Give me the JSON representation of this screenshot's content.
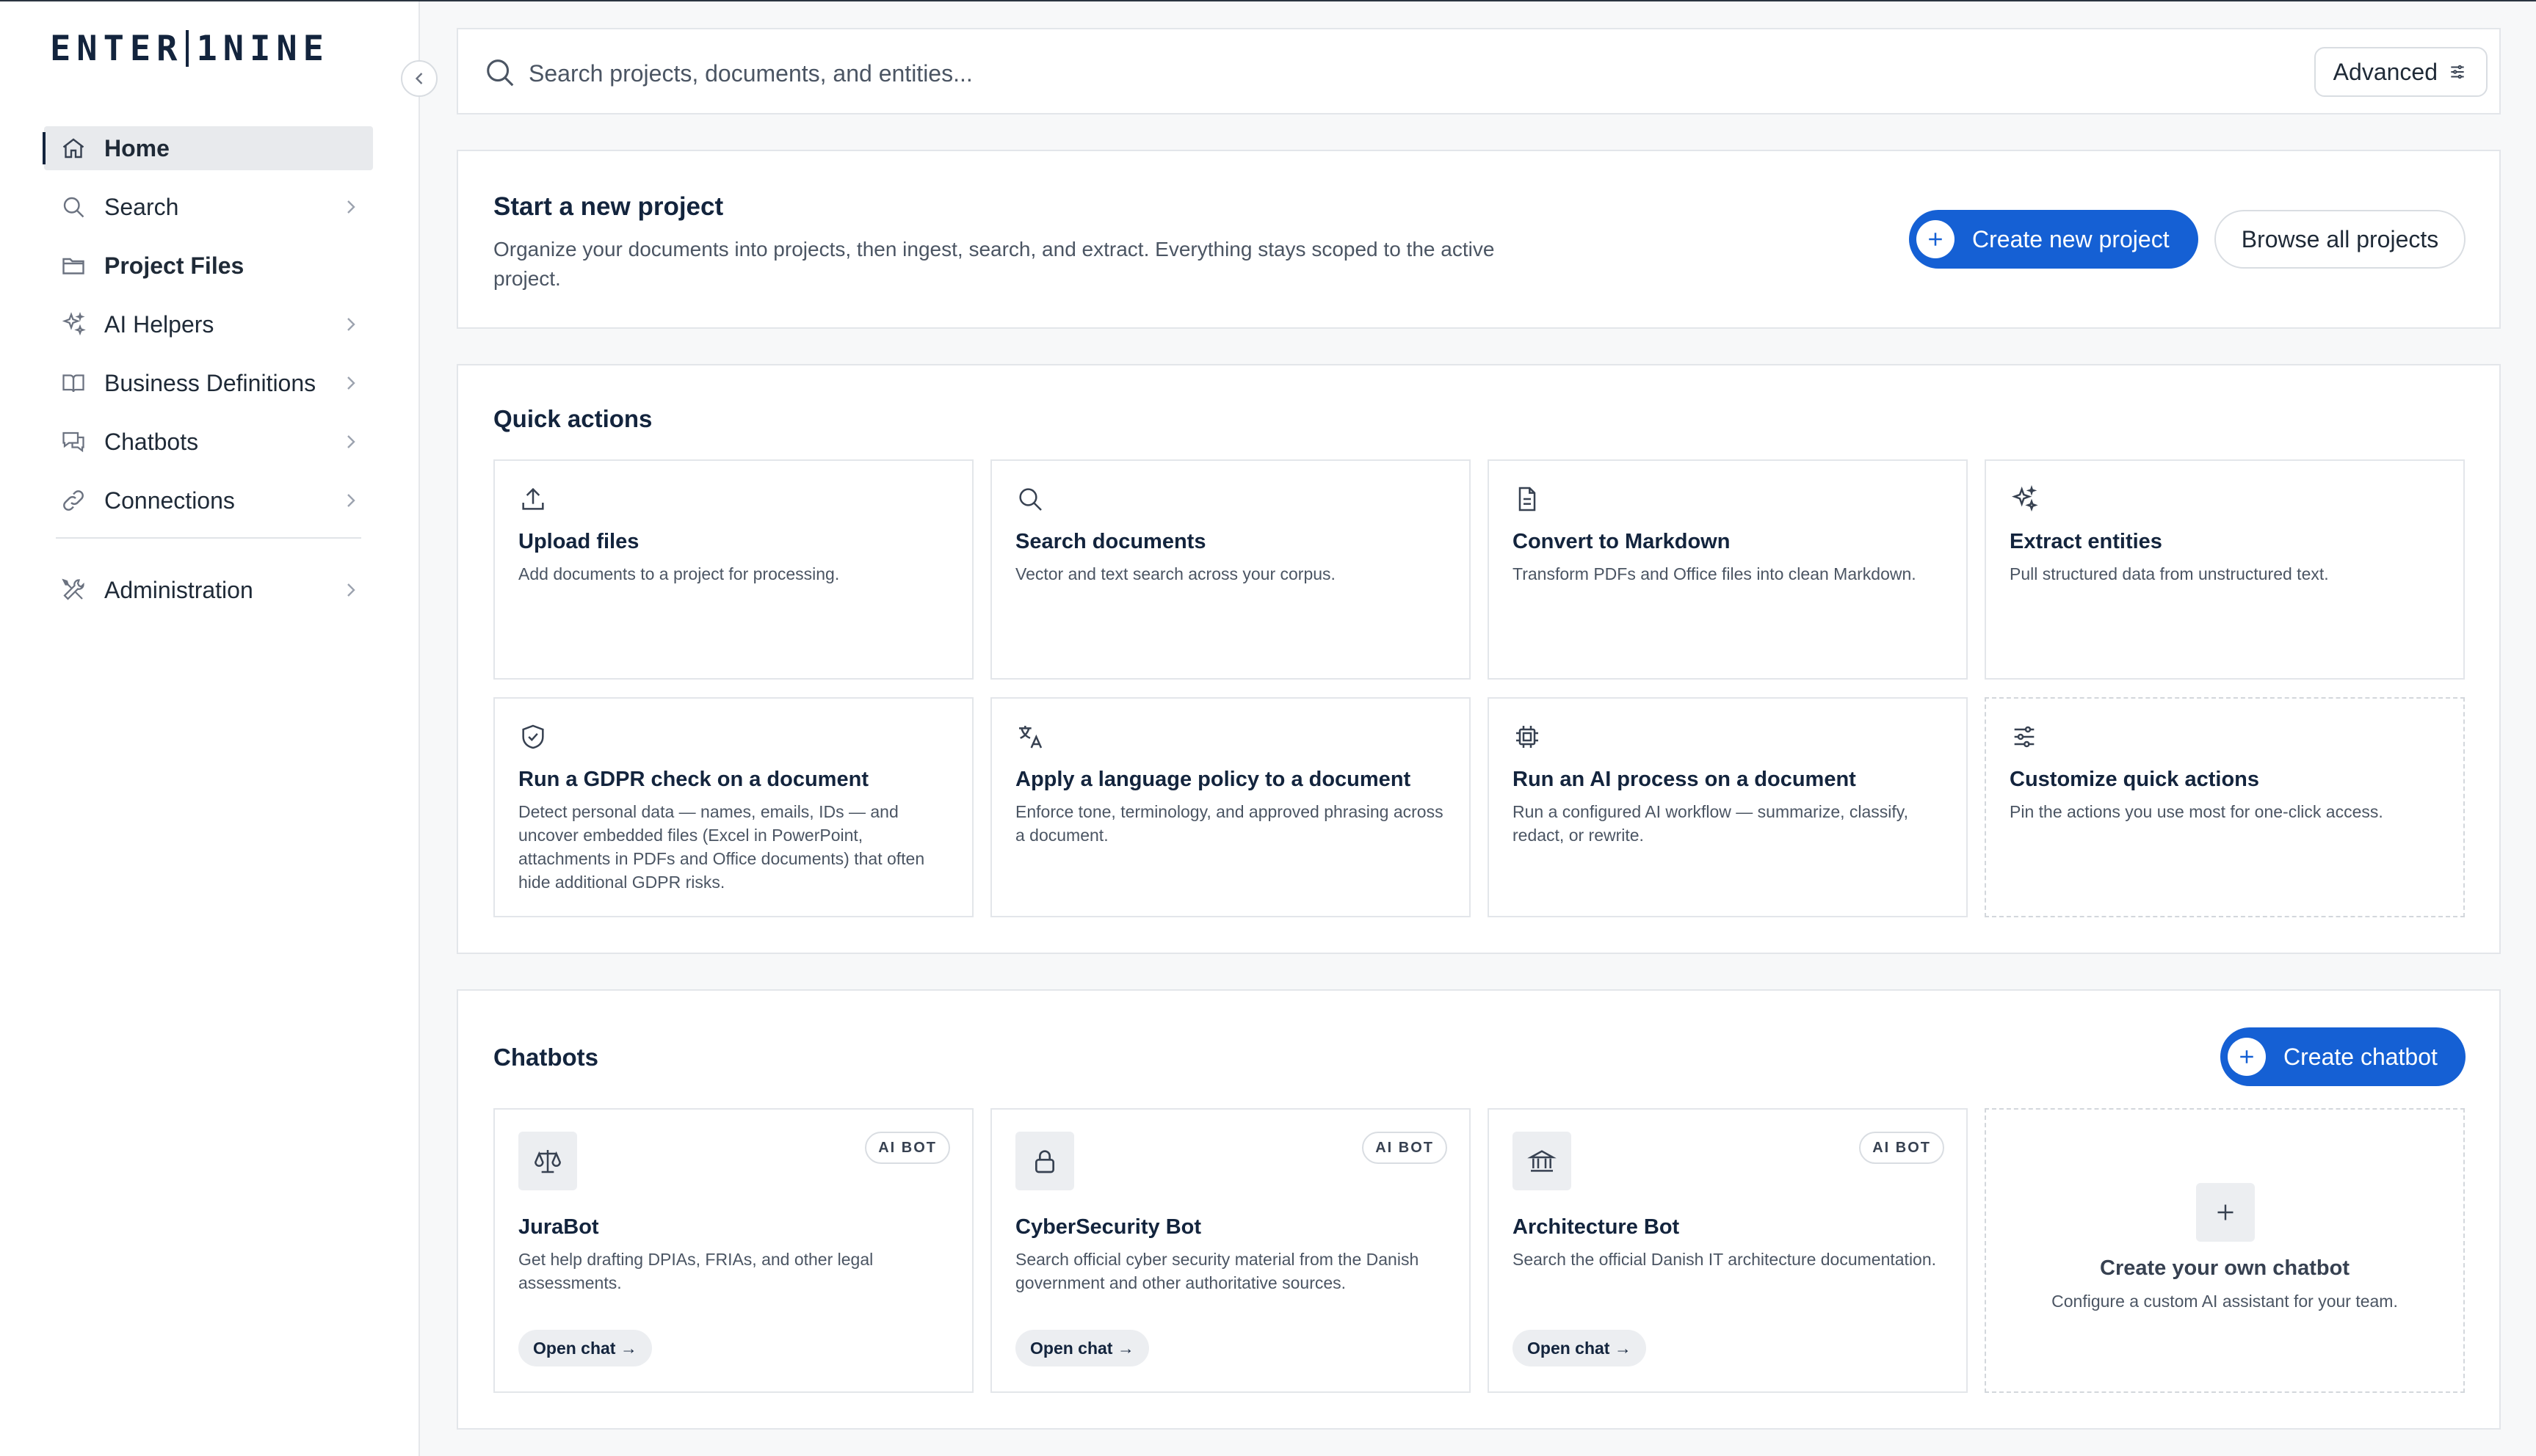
{
  "app": {
    "logo_left": "ENTER",
    "logo_right": "1NINE"
  },
  "colors": {
    "primary": "#1560d4",
    "navy": "#13243d",
    "muted": "#4b5563",
    "border": "#e3e6ea"
  },
  "sidebar": {
    "items": [
      {
        "label": "Home",
        "icon": "home-icon",
        "active": true,
        "chevron": false
      },
      {
        "label": "Search",
        "icon": "search-icon",
        "chevron": true
      },
      {
        "label": "Project Files",
        "icon": "folder-icon",
        "chevron": false,
        "bold": true
      },
      {
        "label": "AI Helpers",
        "icon": "sparkles-icon",
        "chevron": true
      },
      {
        "label": "Business Definitions",
        "icon": "book-icon",
        "chevron": true
      },
      {
        "label": "Chatbots",
        "icon": "chat-icon",
        "chevron": true
      },
      {
        "label": "Connections",
        "icon": "link-icon",
        "chevron": true
      },
      {
        "label": "Administration",
        "icon": "tools-icon",
        "chevron": true
      }
    ]
  },
  "search": {
    "placeholder": "Search projects, documents, and entities...",
    "advanced_label": "Advanced"
  },
  "new_project": {
    "title": "Start a new project",
    "description": "Organize your documents into projects, then ingest, search, and extract. Everything stays scoped to the active project.",
    "create_label": "Create new project",
    "browse_label": "Browse all projects"
  },
  "quick_actions": {
    "title": "Quick actions",
    "items": [
      {
        "title": "Upload files",
        "desc": "Add documents to a project for processing.",
        "icon": "upload-icon"
      },
      {
        "title": "Search documents",
        "desc": "Vector and text search across your corpus.",
        "icon": "search-icon"
      },
      {
        "title": "Convert to Markdown",
        "desc": "Transform PDFs and Office files into clean Markdown.",
        "icon": "document-icon"
      },
      {
        "title": "Extract entities",
        "desc": "Pull structured data from unstructured text.",
        "icon": "sparkles-icon"
      },
      {
        "title": "Run a GDPR check on a document",
        "desc": "Detect personal data — names, emails, IDs — and uncover embedded files (Excel in PowerPoint, attachments in PDFs and Office documents) that often hide additional GDPR risks.",
        "icon": "shield-check-icon"
      },
      {
        "title": "Apply a language policy to a document",
        "desc": "Enforce tone, terminology, and approved phrasing across a document.",
        "icon": "translate-icon"
      },
      {
        "title": "Run an AI process on a document",
        "desc": "Run a configured AI workflow — summarize, classify, redact, or rewrite.",
        "icon": "chip-icon"
      },
      {
        "title": "Customize quick actions",
        "desc": "Pin the actions you use most for one-click access.",
        "icon": "sliders-icon"
      }
    ]
  },
  "chatbots": {
    "title": "Chatbots",
    "create_label": "Create chatbot",
    "badge": "AI BOT",
    "open_label": "Open chat →",
    "items": [
      {
        "title": "JuraBot",
        "desc": "Get help drafting DPIAs, FRIAs, and other legal assessments.",
        "icon": "scale-icon"
      },
      {
        "title": "CyberSecurity Bot",
        "desc": "Search official cyber security material from the Danish government and other authoritative sources.",
        "icon": "lock-icon"
      },
      {
        "title": "Architecture Bot",
        "desc": "Search the official Danish IT architecture documentation.",
        "icon": "bank-icon"
      }
    ],
    "create_own": {
      "title": "Create your own chatbot",
      "desc": "Configure a custom AI assistant for your team."
    }
  }
}
